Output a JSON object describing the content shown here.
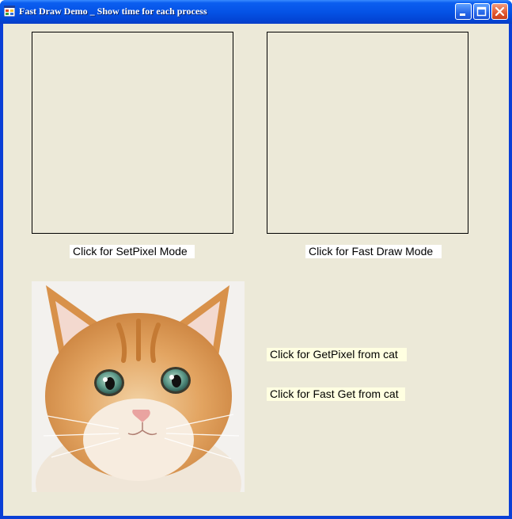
{
  "window": {
    "title": "Fast Draw Demo _ Show time for each process",
    "app_icon": "form-icon",
    "controls": [
      "minimize-icon",
      "maximize-icon",
      "close-icon"
    ]
  },
  "buttons": {
    "setpixel_mode": "Click for SetPixel Mode",
    "fast_draw_mode": "Click for Fast Draw Mode",
    "getpixel_from_cat": "Click for GetPixel from cat",
    "fast_get_from_cat": "Click for Fast Get from cat"
  },
  "image": {
    "subject": "kitten-photo"
  },
  "colors": {
    "client_background": "#ece9d8",
    "titlebar": "#0553e6",
    "label_white": "#ffffff",
    "label_yellow": "#ffffe1"
  }
}
